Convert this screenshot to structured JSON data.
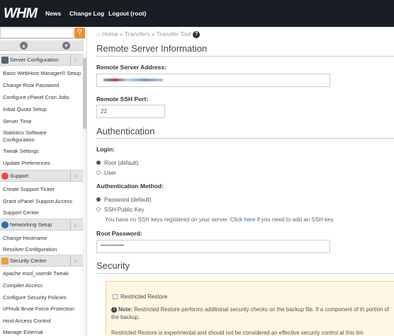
{
  "topbar": {
    "logo": "WHM",
    "nav": [
      "News",
      "Change Log",
      "Logout (root)"
    ]
  },
  "sidebar": {
    "search_icon": "search-icon",
    "categories": [
      {
        "label": "Server Configuration",
        "icon": "server-config-icon",
        "color": "#556270"
      },
      {
        "label": "Support",
        "icon": "support-icon",
        "color": "#e74c3c"
      },
      {
        "label": "Networking Setup",
        "icon": "networking-icon",
        "color": "#2a6db5"
      },
      {
        "label": "Security Center",
        "icon": "lock-icon",
        "color": "#e9a23b"
      }
    ],
    "items": [
      "Basic WebHost Manager® Setup",
      "Change Root Password",
      "Configure cPanel Cron Jobs",
      "Initial Quota Setup",
      "Server Time",
      "Statistics Software",
      "Configuration",
      "Tweak Settings",
      "Update Preferences",
      "Create Support Ticket",
      "Grant cPanel Support Access",
      "Support Center",
      "Change Hostname",
      "Resolver Configuration",
      "Apache mod_userdir Tweak",
      "Compiler Access",
      "Configure Security Policies",
      "cPHulk Brute Force Protection",
      "Host Access Control",
      "Manage External"
    ]
  },
  "breadcrumb": {
    "text": "Home » Transfers » Transfer Tool"
  },
  "remote": {
    "title": "Remote Server Information",
    "address_label": "Remote Server Address:",
    "port_label": "Remote SSH Port:",
    "port_value": "22"
  },
  "auth": {
    "title": "Authentication",
    "login_label": "Login:",
    "login_options": [
      "Root (default)",
      "User"
    ],
    "method_label": "Authentication Method:",
    "method_options": [
      "Password (default)",
      "SSH Public Key"
    ],
    "ssh_hint_before": "You have no SSH keys registered on your server. Click ",
    "ssh_hint_link": "here",
    "ssh_hint_after": " if you need to add an SSH key.",
    "root_pw_label": "Root Password:",
    "root_pw_value": "••••••••••••••••"
  },
  "security": {
    "title": "Security",
    "restore_label": "Restricted Restore",
    "note_bold": "Note:",
    "note_text": " Restricted Restore performs additional security checks on the backup file. If a component of th portion of the backup.",
    "note2_text": "Restricted Restore is experimental and should not be considered an effective security control at this tim"
  }
}
